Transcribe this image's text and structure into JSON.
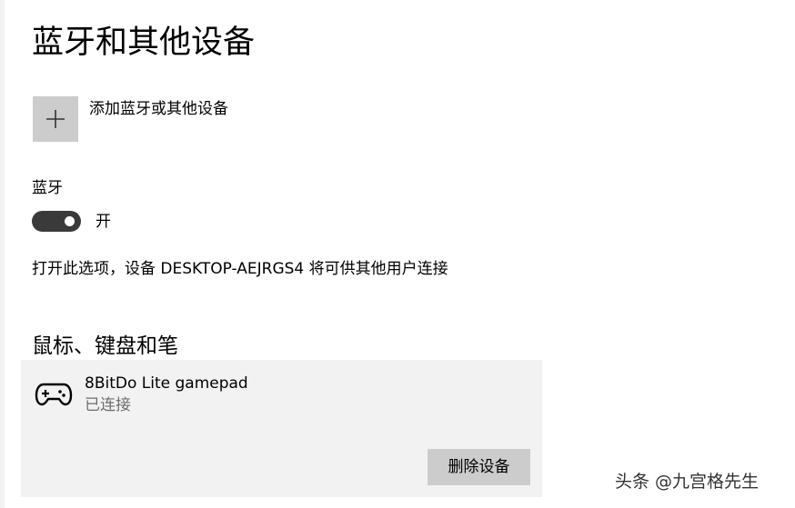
{
  "page": {
    "title": "蓝牙和其他设备"
  },
  "add_device": {
    "icon": "plus-icon",
    "label": "添加蓝牙或其他设备"
  },
  "bluetooth": {
    "heading": "蓝牙",
    "toggle_on": true,
    "state_label": "开",
    "info": "打开此选项，设备 DESKTOP-AEJRGS4 将可供其他用户连接"
  },
  "mouse_section": {
    "heading": "鼠标、键盘和笔",
    "devices": [
      {
        "icon": "gamepad-icon",
        "name": "8BitDo Lite gamepad",
        "status": "已连接",
        "remove_label": "删除设备"
      }
    ]
  },
  "watermark": {
    "text": "头条 @九宫格先生"
  },
  "colors": {
    "toggle_on": "#3a3a3a",
    "card_bg": "#f2f2f2",
    "button_bg": "#cccccc",
    "secondary_text": "#6d6d6d"
  }
}
